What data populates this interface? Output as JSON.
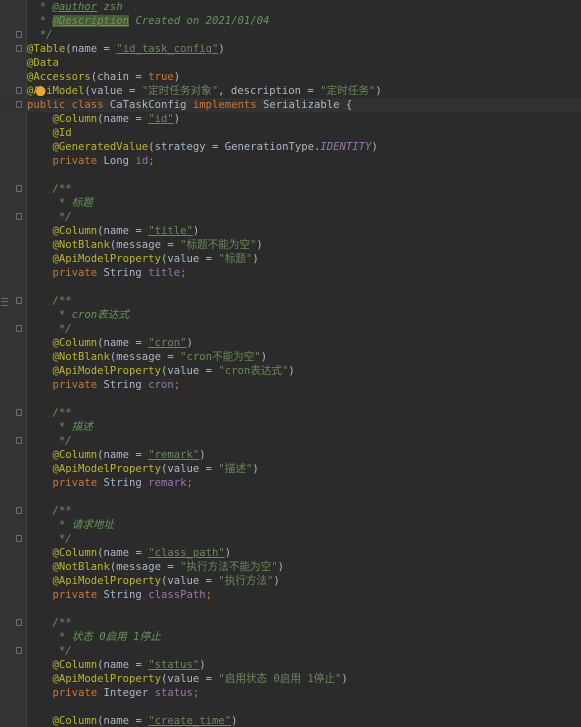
{
  "editor": {
    "current_line_index": 7,
    "lines": [
      [
        {
          "t": "comment",
          "v": "  * "
        },
        {
          "t": "doctag",
          "v": "@author"
        },
        {
          "t": "comment",
          "v": " zsh"
        }
      ],
      [
        {
          "t": "comment",
          "v": "  * "
        },
        {
          "t": "doctag hl",
          "v": "@Description"
        },
        {
          "t": "comment",
          "v": " Created on 2021/01/04"
        }
      ],
      [
        {
          "t": "comment",
          "v": "  */"
        }
      ],
      [
        {
          "t": "annotation",
          "v": "@Table"
        },
        {
          "t": "text",
          "v": "(name = "
        },
        {
          "t": "string u",
          "v": "\"id_task_config\""
        },
        {
          "t": "text",
          "v": ")"
        }
      ],
      [
        {
          "t": "annotation",
          "v": "@Data"
        }
      ],
      [
        {
          "t": "annotation",
          "v": "@Accessors"
        },
        {
          "t": "text",
          "v": "(chain = "
        },
        {
          "t": "keyword",
          "v": "true"
        },
        {
          "t": "text",
          "v": ")"
        }
      ],
      [
        {
          "t": "annotation",
          "v": "@ApiModel"
        },
        {
          "t": "text",
          "v": "(value = "
        },
        {
          "t": "string",
          "v": "\"定时任务对象\""
        },
        {
          "t": "text",
          "v": ", description = "
        },
        {
          "t": "string",
          "v": "\"定时任务\""
        },
        {
          "t": "text",
          "v": ")"
        }
      ],
      [
        {
          "t": "keyword",
          "v": "public class "
        },
        {
          "t": "text",
          "v": "CaTaskConfig "
        },
        {
          "t": "keyword",
          "v": "implements "
        },
        {
          "t": "text",
          "v": "Serializable {"
        }
      ],
      [
        {
          "t": "text",
          "v": "    "
        },
        {
          "t": "annotation",
          "v": "@Column"
        },
        {
          "t": "text",
          "v": "(name = "
        },
        {
          "t": "string u",
          "v": "\"id\""
        },
        {
          "t": "text",
          "v": ")"
        }
      ],
      [
        {
          "t": "text",
          "v": "    "
        },
        {
          "t": "annotation",
          "v": "@Id"
        }
      ],
      [
        {
          "t": "text",
          "v": "    "
        },
        {
          "t": "annotation",
          "v": "@GeneratedValue"
        },
        {
          "t": "text",
          "v": "(strategy = GenerationType."
        },
        {
          "t": "static",
          "v": "IDENTITY"
        },
        {
          "t": "text",
          "v": ")"
        }
      ],
      [
        {
          "t": "text",
          "v": "    "
        },
        {
          "t": "keyword",
          "v": "private "
        },
        {
          "t": "text",
          "v": "Long "
        },
        {
          "t": "field",
          "v": "id"
        },
        {
          "t": "keyword",
          "v": ";"
        }
      ],
      [],
      [
        {
          "t": "comment",
          "v": "    /**"
        }
      ],
      [
        {
          "t": "comment",
          "v": "     * 标题"
        }
      ],
      [
        {
          "t": "comment",
          "v": "     */"
        }
      ],
      [
        {
          "t": "text",
          "v": "    "
        },
        {
          "t": "annotation",
          "v": "@Column"
        },
        {
          "t": "text",
          "v": "(name = "
        },
        {
          "t": "string u",
          "v": "\"title\""
        },
        {
          "t": "text",
          "v": ")"
        }
      ],
      [
        {
          "t": "text",
          "v": "    "
        },
        {
          "t": "annotation",
          "v": "@NotBlank"
        },
        {
          "t": "text",
          "v": "(message = "
        },
        {
          "t": "string",
          "v": "\"标题不能为空\""
        },
        {
          "t": "text",
          "v": ")"
        }
      ],
      [
        {
          "t": "text",
          "v": "    "
        },
        {
          "t": "annotation",
          "v": "@ApiModelProperty"
        },
        {
          "t": "text",
          "v": "(value = "
        },
        {
          "t": "string",
          "v": "\"标题\""
        },
        {
          "t": "text",
          "v": ")"
        }
      ],
      [
        {
          "t": "text",
          "v": "    "
        },
        {
          "t": "keyword",
          "v": "private "
        },
        {
          "t": "text",
          "v": "String "
        },
        {
          "t": "field",
          "v": "title"
        },
        {
          "t": "keyword",
          "v": ";"
        }
      ],
      [],
      [
        {
          "t": "comment",
          "v": "    /**"
        }
      ],
      [
        {
          "t": "comment",
          "v": "     * cron表达式"
        }
      ],
      [
        {
          "t": "comment",
          "v": "     */"
        }
      ],
      [
        {
          "t": "text",
          "v": "    "
        },
        {
          "t": "annotation",
          "v": "@Column"
        },
        {
          "t": "text",
          "v": "(name = "
        },
        {
          "t": "string u",
          "v": "\"cron\""
        },
        {
          "t": "text",
          "v": ")"
        }
      ],
      [
        {
          "t": "text",
          "v": "    "
        },
        {
          "t": "annotation",
          "v": "@NotBlank"
        },
        {
          "t": "text",
          "v": "(message = "
        },
        {
          "t": "string",
          "v": "\"cron不能为空\""
        },
        {
          "t": "text",
          "v": ")"
        }
      ],
      [
        {
          "t": "text",
          "v": "    "
        },
        {
          "t": "annotation",
          "v": "@ApiModelProperty"
        },
        {
          "t": "text",
          "v": "(value = "
        },
        {
          "t": "string",
          "v": "\"cron表达式\""
        },
        {
          "t": "text",
          "v": ")"
        }
      ],
      [
        {
          "t": "text",
          "v": "    "
        },
        {
          "t": "keyword",
          "v": "private "
        },
        {
          "t": "text",
          "v": "String "
        },
        {
          "t": "field",
          "v": "cron"
        },
        {
          "t": "keyword",
          "v": ";"
        }
      ],
      [],
      [
        {
          "t": "comment",
          "v": "    /**"
        }
      ],
      [
        {
          "t": "comment",
          "v": "     * 描述"
        }
      ],
      [
        {
          "t": "comment",
          "v": "     */"
        }
      ],
      [
        {
          "t": "text",
          "v": "    "
        },
        {
          "t": "annotation",
          "v": "@Column"
        },
        {
          "t": "text",
          "v": "(name = "
        },
        {
          "t": "string u",
          "v": "\"remark\""
        },
        {
          "t": "text",
          "v": ")"
        }
      ],
      [
        {
          "t": "text",
          "v": "    "
        },
        {
          "t": "annotation",
          "v": "@ApiModelProperty"
        },
        {
          "t": "text",
          "v": "(value = "
        },
        {
          "t": "string",
          "v": "\"描述\""
        },
        {
          "t": "text",
          "v": ")"
        }
      ],
      [
        {
          "t": "text",
          "v": "    "
        },
        {
          "t": "keyword",
          "v": "private "
        },
        {
          "t": "text",
          "v": "String "
        },
        {
          "t": "field",
          "v": "remark"
        },
        {
          "t": "keyword",
          "v": ";"
        }
      ],
      [],
      [
        {
          "t": "comment",
          "v": "    /**"
        }
      ],
      [
        {
          "t": "comment",
          "v": "     * 请求地址"
        }
      ],
      [
        {
          "t": "comment",
          "v": "     */"
        }
      ],
      [
        {
          "t": "text",
          "v": "    "
        },
        {
          "t": "annotation",
          "v": "@Column"
        },
        {
          "t": "text",
          "v": "(name = "
        },
        {
          "t": "string u",
          "v": "\"class_path\""
        },
        {
          "t": "text",
          "v": ")"
        }
      ],
      [
        {
          "t": "text",
          "v": "    "
        },
        {
          "t": "annotation",
          "v": "@NotBlank"
        },
        {
          "t": "text",
          "v": "(message = "
        },
        {
          "t": "string",
          "v": "\"执行方法不能为空\""
        },
        {
          "t": "text",
          "v": ")"
        }
      ],
      [
        {
          "t": "text",
          "v": "    "
        },
        {
          "t": "annotation",
          "v": "@ApiModelProperty"
        },
        {
          "t": "text",
          "v": "(value = "
        },
        {
          "t": "string",
          "v": "\"执行方法\""
        },
        {
          "t": "text",
          "v": ")"
        }
      ],
      [
        {
          "t": "text",
          "v": "    "
        },
        {
          "t": "keyword",
          "v": "private "
        },
        {
          "t": "text",
          "v": "String "
        },
        {
          "t": "field",
          "v": "classPath"
        },
        {
          "t": "keyword",
          "v": ";"
        }
      ],
      [],
      [
        {
          "t": "comment",
          "v": "    /**"
        }
      ],
      [
        {
          "t": "comment",
          "v": "     * 状态 0启用 1停止"
        }
      ],
      [
        {
          "t": "comment",
          "v": "     */"
        }
      ],
      [
        {
          "t": "text",
          "v": "    "
        },
        {
          "t": "annotation",
          "v": "@Column"
        },
        {
          "t": "text",
          "v": "(name = "
        },
        {
          "t": "string u",
          "v": "\"status\""
        },
        {
          "t": "text",
          "v": ")"
        }
      ],
      [
        {
          "t": "text",
          "v": "    "
        },
        {
          "t": "annotation",
          "v": "@ApiModelProperty"
        },
        {
          "t": "text",
          "v": "(value = "
        },
        {
          "t": "string",
          "v": "\"启用状态 0启用 1停止\""
        },
        {
          "t": "text",
          "v": ")"
        }
      ],
      [
        {
          "t": "text",
          "v": "    "
        },
        {
          "t": "keyword",
          "v": "private "
        },
        {
          "t": "text",
          "v": "Integer "
        },
        {
          "t": "field",
          "v": "status"
        },
        {
          "t": "keyword",
          "v": ";"
        }
      ],
      [],
      [
        {
          "t": "text",
          "v": "    "
        },
        {
          "t": "annotation",
          "v": "@Column"
        },
        {
          "t": "text",
          "v": "(name = "
        },
        {
          "t": "string u",
          "v": "\"create_time\""
        },
        {
          "t": "text",
          "v": ")"
        }
      ]
    ],
    "fold_markers": [
      2,
      3,
      6,
      7,
      13,
      15,
      21,
      23,
      29,
      31,
      36,
      38,
      44,
      46
    ],
    "gutter_icon_line": 21,
    "intention_bulb_line": 6
  },
  "colors": {
    "background": "#2b2b2b",
    "gutter": "#313335",
    "current_line": "#323232",
    "comment": "#629755",
    "annotation": "#bbb529",
    "string": "#6a8759",
    "keyword": "#cc7832",
    "field": "#9876aa",
    "text": "#a9b7c6",
    "bulb": "#f0a732"
  }
}
